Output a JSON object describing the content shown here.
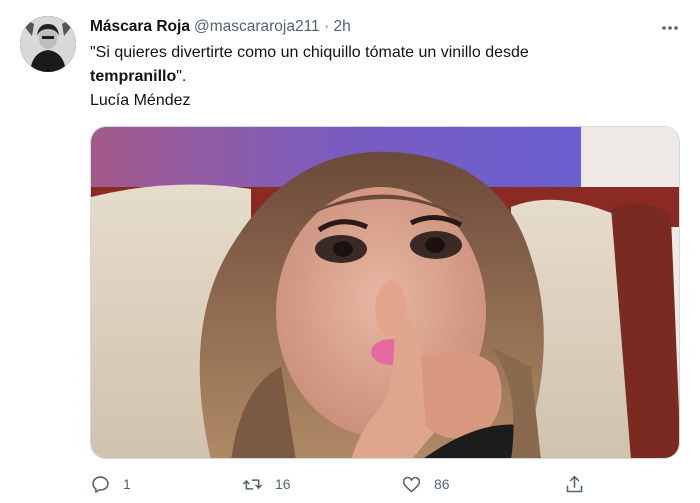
{
  "tweet": {
    "author_name": "Máscara Roja",
    "handle": "@mascararoja211",
    "separator": "·",
    "time": "2h",
    "text_line1": "\"Si quieres divertirte como un chiquillo tómate un vinillo desde",
    "text_bold": "tempranillo",
    "text_after_bold": "\".",
    "text_line3": "Lucía Méndez"
  },
  "actions": {
    "reply_count": "1",
    "retweet_count": "16",
    "like_count": "86"
  },
  "icons": {
    "more": "more-horizontal-icon",
    "reply": "reply-icon",
    "retweet": "retweet-icon",
    "like": "heart-icon",
    "share": "share-icon"
  },
  "colors": {
    "text": "#0f1419",
    "secondary": "#536471",
    "border": "#cfd9de"
  }
}
